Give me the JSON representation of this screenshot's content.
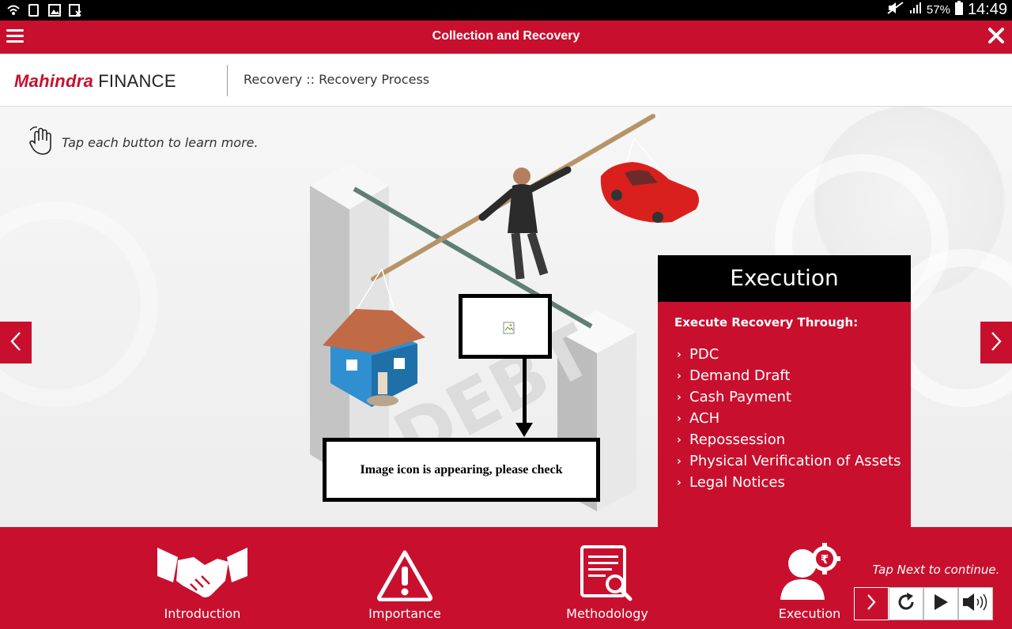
{
  "status_bar": {
    "battery": "57%",
    "time": "14:49"
  },
  "app_bar": {
    "title": "Collection and Recovery"
  },
  "header": {
    "logo_brand": "Mahindra",
    "logo_finance": "FINANCE",
    "breadcrumb": "Recovery :: Recovery Process"
  },
  "stage": {
    "hint": "Tap each button to learn more."
  },
  "panel": {
    "title": "Execution",
    "subtitle": "Execute Recovery Through:",
    "items": [
      "PDC",
      "Demand Draft",
      "Cash Payment",
      "ACH",
      "Repossession",
      "Physical Verification of Assets",
      "Legal Notices"
    ]
  },
  "annotation": {
    "note": "Image icon is appearing, please check"
  },
  "bottom": {
    "tabs": [
      {
        "label": "Introduction",
        "icon": "handshake-icon"
      },
      {
        "label": "Importance",
        "icon": "warning-icon"
      },
      {
        "label": "Methodology",
        "icon": "document-search-icon"
      },
      {
        "label": "Execution",
        "icon": "person-rupee-gear-icon"
      }
    ],
    "tap_next": "Tap Next to continue."
  },
  "colors": {
    "brand_red": "#c8102e",
    "black": "#000000"
  }
}
